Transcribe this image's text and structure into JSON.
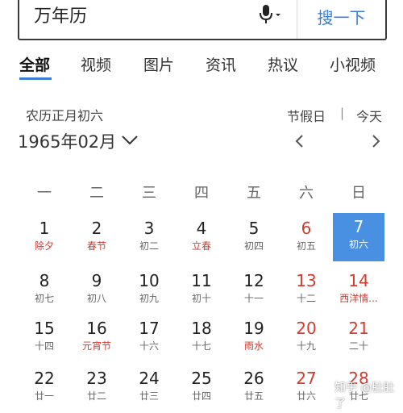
{
  "search": {
    "query": "万年历",
    "button_label": "搜一下"
  },
  "tabs": [
    {
      "label": "全部",
      "active": true
    },
    {
      "label": "视频"
    },
    {
      "label": "图片"
    },
    {
      "label": "资讯"
    },
    {
      "label": "热议"
    },
    {
      "label": "小视频"
    }
  ],
  "calendar": {
    "lunar_date": "农历正月初六",
    "month_label": "1965年02月",
    "holiday_link": "节假日",
    "separator": "|",
    "today_link": "今天",
    "weekdays": [
      "一",
      "二",
      "三",
      "四",
      "五",
      "六",
      "日"
    ],
    "weeks": [
      [
        {
          "day": "1",
          "sub": "除夕",
          "festival": true
        },
        {
          "day": "2",
          "sub": "春节",
          "festival": true
        },
        {
          "day": "3",
          "sub": "初二"
        },
        {
          "day": "4",
          "sub": "立春",
          "festival": true
        },
        {
          "day": "5",
          "sub": "初四"
        },
        {
          "day": "6",
          "sub": "初五",
          "weekend": true
        },
        {
          "day": "7",
          "sub": "初六",
          "weekend": true,
          "selected": true
        }
      ],
      [
        {
          "day": "8",
          "sub": "初七"
        },
        {
          "day": "9",
          "sub": "初八"
        },
        {
          "day": "10",
          "sub": "初九"
        },
        {
          "day": "11",
          "sub": "初十"
        },
        {
          "day": "12",
          "sub": "十一"
        },
        {
          "day": "13",
          "sub": "十二",
          "weekend": true
        },
        {
          "day": "14",
          "sub": "西洋情...",
          "weekend": true,
          "festival": true
        }
      ],
      [
        {
          "day": "15",
          "sub": "十四"
        },
        {
          "day": "16",
          "sub": "元宵节",
          "festival": true
        },
        {
          "day": "17",
          "sub": "十六"
        },
        {
          "day": "18",
          "sub": "十七"
        },
        {
          "day": "19",
          "sub": "雨水",
          "festival": true
        },
        {
          "day": "20",
          "sub": "十九",
          "weekend": true
        },
        {
          "day": "21",
          "sub": "二十",
          "weekend": true
        }
      ],
      [
        {
          "day": "22",
          "sub": "廿一"
        },
        {
          "day": "23",
          "sub": "廿二"
        },
        {
          "day": "24",
          "sub": "廿三"
        },
        {
          "day": "25",
          "sub": "廿四"
        },
        {
          "day": "26",
          "sub": "廿五"
        },
        {
          "day": "27",
          "sub": "廿六",
          "weekend": true
        },
        {
          "day": "28",
          "sub": "廿七",
          "weekend": true
        }
      ]
    ]
  },
  "watermark": "知乎 @肚肚了"
}
